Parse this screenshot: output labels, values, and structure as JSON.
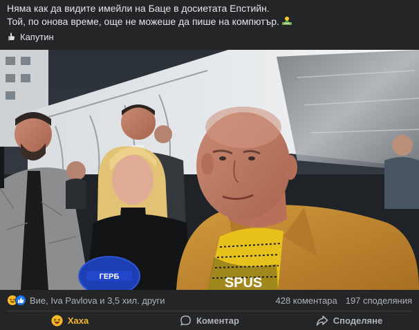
{
  "post": {
    "line1": "Няма как да видите имейли на Баце в досиетата Епстийн.",
    "line2": "Той, по онова време, още не можеше да пише на компютър.",
    "line2_emoji_icon": "person-at-computer-emoji-icon",
    "tag_icon": "hand-pointing-icon",
    "tag_label": "Капутин"
  },
  "photo": {
    "microphone_label": "ГЕРБ",
    "shirt_text": "SPUS"
  },
  "stats": {
    "reaction_icons": [
      "haha-icon",
      "like-icon"
    ],
    "reactors_text": "Вие, Iva Pavlova и 3,5 хил. други",
    "comments_text": "428 коментара",
    "shares_text": "197 споделяния"
  },
  "actions": {
    "react_label": "Хаха",
    "react_icon": "haha-emoji-icon",
    "comment_label": "Коментар",
    "comment_icon": "comment-bubble-icon",
    "share_label": "Споделяне",
    "share_icon": "share-arrow-icon"
  },
  "colors": {
    "background": "#242526",
    "text_primary": "#e4e6eb",
    "text_secondary": "#b0b3b8",
    "haha_active": "#f7b928",
    "like_blue": "#1877f2",
    "divider": "#3e4042"
  }
}
